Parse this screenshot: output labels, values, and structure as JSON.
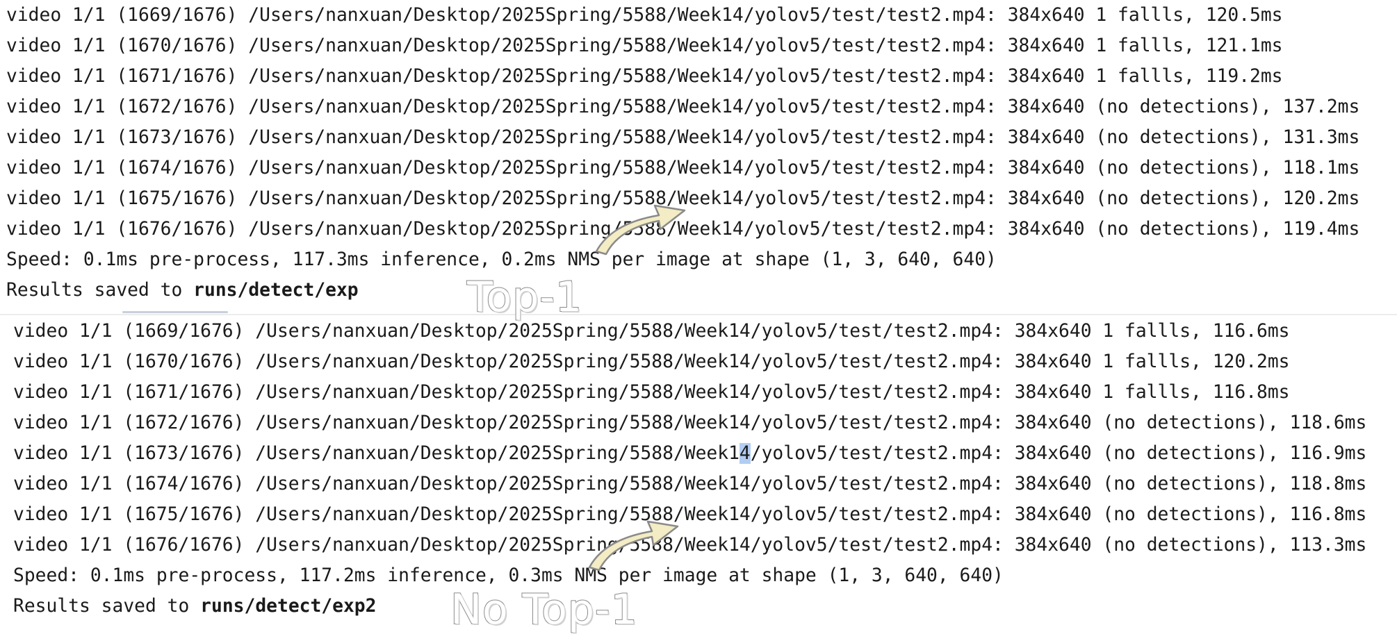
{
  "top_log": {
    "lines": [
      "video 1/1 (1669/1676) /Users/nanxuan/Desktop/2025Spring/5588/Week14/yolov5/test/test2.mp4: 384x640 1 fallls, 120.5ms",
      "video 1/1 (1670/1676) /Users/nanxuan/Desktop/2025Spring/5588/Week14/yolov5/test/test2.mp4: 384x640 1 fallls, 121.1ms",
      "video 1/1 (1671/1676) /Users/nanxuan/Desktop/2025Spring/5588/Week14/yolov5/test/test2.mp4: 384x640 1 fallls, 119.2ms",
      "video 1/1 (1672/1676) /Users/nanxuan/Desktop/2025Spring/5588/Week14/yolov5/test/test2.mp4: 384x640 (no detections), 137.2ms",
      "video 1/1 (1673/1676) /Users/nanxuan/Desktop/2025Spring/5588/Week14/yolov5/test/test2.mp4: 384x640 (no detections), 131.3ms",
      "video 1/1 (1674/1676) /Users/nanxuan/Desktop/2025Spring/5588/Week14/yolov5/test/test2.mp4: 384x640 (no detections), 118.1ms",
      "video 1/1 (1675/1676) /Users/nanxuan/Desktop/2025Spring/5588/Week14/yolov5/test/test2.mp4: 384x640 (no detections), 120.2ms",
      "video 1/1 (1676/1676) /Users/nanxuan/Desktop/2025Spring/5588/Week14/yolov5/test/test2.mp4: 384x640 (no detections), 119.4ms",
      "Speed: 0.1ms pre-process, 117.3ms inference, 0.2ms NMS per image at shape (1, 3, 640, 640)"
    ],
    "saved_prefix": "Results saved to ",
    "saved_path": "runs/detect/exp",
    "annotation": "Top-1"
  },
  "bottom_log": {
    "lines": [
      "video 1/1 (1669/1676) /Users/nanxuan/Desktop/2025Spring/5588/Week14/yolov5/test/test2.mp4: 384x640 1 fallls, 116.6ms",
      "video 1/1 (1670/1676) /Users/nanxuan/Desktop/2025Spring/5588/Week14/yolov5/test/test2.mp4: 384x640 1 fallls, 120.2ms",
      "video 1/1 (1671/1676) /Users/nanxuan/Desktop/2025Spring/5588/Week14/yolov5/test/test2.mp4: 384x640 1 fallls, 116.8ms",
      "video 1/1 (1672/1676) /Users/nanxuan/Desktop/2025Spring/5588/Week14/yolov5/test/test2.mp4: 384x640 (no detections), 118.6ms",
      "video 1/1 (1673/1676) /Users/nanxuan/Desktop/2025Spring/5588/Week14/yolov5/test/test2.mp4: 384x640 (no detections), 116.9ms",
      "video 1/1 (1674/1676) /Users/nanxuan/Desktop/2025Spring/5588/Week14/yolov5/test/test2.mp4: 384x640 (no detections), 118.8ms",
      "video 1/1 (1675/1676) /Users/nanxuan/Desktop/2025Spring/5588/Week14/yolov5/test/test2.mp4: 384x640 (no detections), 116.8ms",
      "video 1/1 (1676/1676) /Users/nanxuan/Desktop/2025Spring/5588/Week14/yolov5/test/test2.mp4: 384x640 (no detections), 113.3ms",
      "Speed: 0.1ms pre-process, 117.2ms inference, 0.3ms NMS per image at shape (1, 3, 640, 640)"
    ],
    "saved_prefix": "Results saved to ",
    "saved_path": "runs/detect/exp2",
    "annotation": "No Top-1",
    "selection": {
      "line_index": 4,
      "before": "video 1/1 (1673/1676) /Users/nanxuan/Desktop/2025Spring/5588/Week1",
      "selected": "4",
      "after": "/yolov5/test/test2.mp4: 384x640 (no detections), 116.9ms"
    }
  },
  "colors": {
    "text": "#1a1a1a",
    "background": "#ffffff",
    "selection": "#b3cdf2",
    "annotation_stroke": "#8a8a8a",
    "arrow_fill": "#f3ecc4"
  }
}
